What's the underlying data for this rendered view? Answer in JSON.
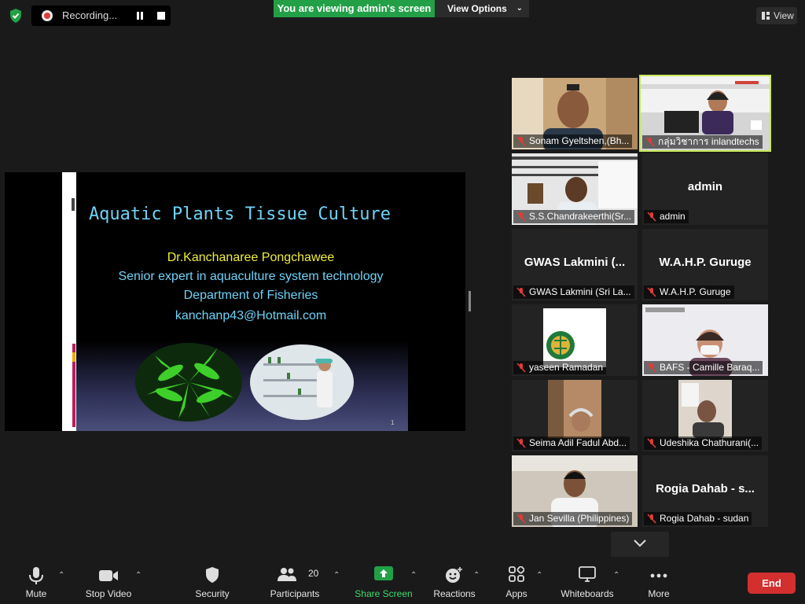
{
  "topbar": {
    "recording_label": "Recording...",
    "viewing_banner": "You are viewing admin's screen",
    "view_options_label": "View Options",
    "view_label": "View"
  },
  "slide": {
    "title": "Aquatic Plants Tissue Culture",
    "presenter": "Dr.Kanchanaree Pongchawee",
    "role": "Senior expert in aquaculture system technology",
    "department": "Department of Fisheries",
    "email": "kanchanp43@Hotmail.com",
    "page_number": "1"
  },
  "participants": [
    {
      "name": "Sonam Gyeltshen,(Bh...",
      "kind": "video"
    },
    {
      "name": "กลุ่มวิชาการ inlandtechs",
      "kind": "video",
      "active": true
    },
    {
      "name": "S.S.Chandrakeerthi(Sr...",
      "kind": "video"
    },
    {
      "name": "admin",
      "kind": "name",
      "big": "admin"
    },
    {
      "name": "GWAS Lakmini (Sri La...",
      "kind": "name",
      "big": "GWAS Lakmini (..."
    },
    {
      "name": "W.A.H.P. Guruge",
      "kind": "name",
      "big": "W.A.H.P. Guruge"
    },
    {
      "name": "yaseen Ramadan",
      "kind": "logo"
    },
    {
      "name": "BAFS - Camille Baraq...",
      "kind": "video"
    },
    {
      "name": "Seima Adil Fadul Abd...",
      "kind": "video"
    },
    {
      "name": "Udeshika Chathurani(...",
      "kind": "video"
    },
    {
      "name": "Jan Sevilla (Philippines)",
      "kind": "video"
    },
    {
      "name": "Rogia Dahab - sudan",
      "kind": "name",
      "big": "Rogia Dahab - s..."
    }
  ],
  "toolbar": {
    "mute": "Mute",
    "stop_video": "Stop Video",
    "security": "Security",
    "participants": "Participants",
    "participants_count": "20",
    "share_screen": "Share Screen",
    "reactions": "Reactions",
    "apps": "Apps",
    "whiteboards": "Whiteboards",
    "more": "More",
    "end": "End"
  },
  "colors": {
    "accent_green": "#23a047",
    "active_speaker": "#c6e95b",
    "end_red": "#d32f2f",
    "muted_red": "#e03b3b"
  }
}
